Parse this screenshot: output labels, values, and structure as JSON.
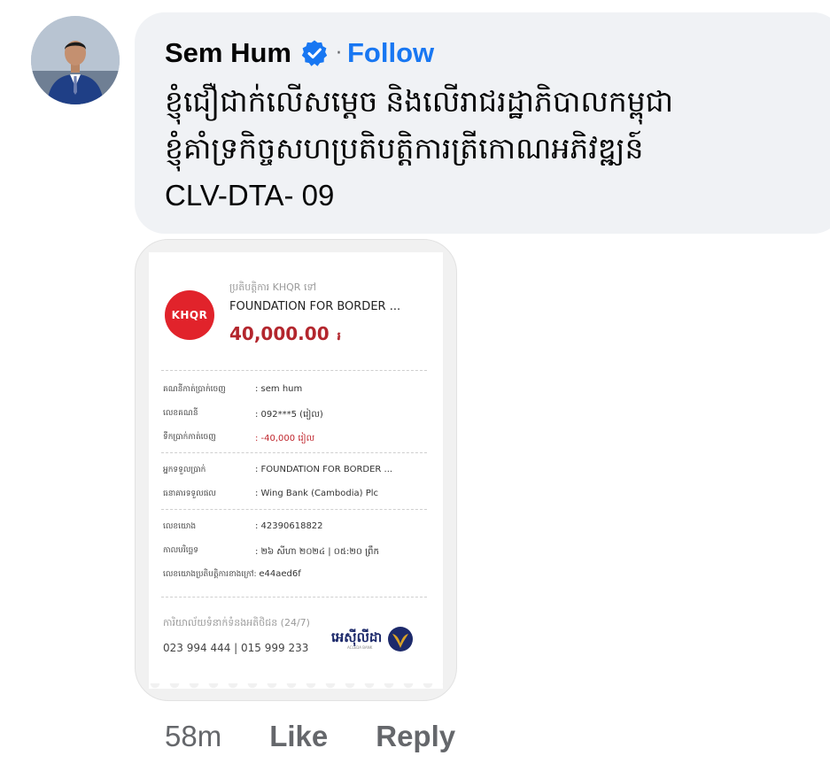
{
  "comment": {
    "author": "Sem Hum",
    "verified": true,
    "separator": "·",
    "follow_label": "Follow",
    "text": "ខ្ញុំជឿជាក់លើសម្ដេច និងលើរាជរដ្ឋាភិបាលកម្ពុជា\nខ្ញុំគាំទ្រកិច្ចសហប្រតិបត្តិការត្រីកោណអភិវឌ្ឍន៍\nCLV-DTA- 09",
    "time": "58m",
    "like_label": "Like",
    "reply_label": "Reply"
  },
  "receipt": {
    "logo_text": "KHQR",
    "subtitle": "ប្រតិបត្តិការ KHQR ទៅ",
    "destination": "FOUNDATION FOR BORDER ...",
    "amount": "40,000.00",
    "currency_symbol": "៛",
    "rows": [
      {
        "label": "គណនីកាត់ប្រាក់ចេញ",
        "value": ": sem hum"
      },
      {
        "label": "លេខគណនី",
        "value": ": 092***5 (រៀល)"
      },
      {
        "label": "ទឹកប្រាក់កាត់ចេញ",
        "value": ": -40,000 រៀល"
      },
      {
        "label": "អ្នកទទួលប្រាក់",
        "value": ": FOUNDATION FOR BORDER ..."
      },
      {
        "label": "ធនាគារទទួលផល",
        "value": ": Wing Bank (Cambodia) Plc"
      },
      {
        "label": "លេខយោង",
        "value": ": 42390618822"
      },
      {
        "label": "កាលបរិច្ឆេទ",
        "value": ": ២៦ សីហា ២០២៤ | ០៥:២០ ព្រឹក"
      }
    ],
    "external_ref_label": "លេខយោងប្រតិបត្តិការខាងក្រៅ:",
    "external_ref_value": "e44aed6f",
    "support_label": "ការិយាល័យទំនាក់ទំនងអតិថិជន (24/7)",
    "phones": "023 994 444 | 015 999 233",
    "bank_name": "អេស៊ីលីដា",
    "bank_sub": "ACLEDA BANK",
    "colors": {
      "khqr_red": "#e1232b",
      "amount_red": "#b3262d",
      "acleda_blue": "#1d2a6b",
      "acleda_gold": "#d9a227"
    }
  },
  "colors": {
    "link_blue": "#1877f2",
    "bubble_bg": "#f0f2f5",
    "meta_gray": "#65676b"
  }
}
